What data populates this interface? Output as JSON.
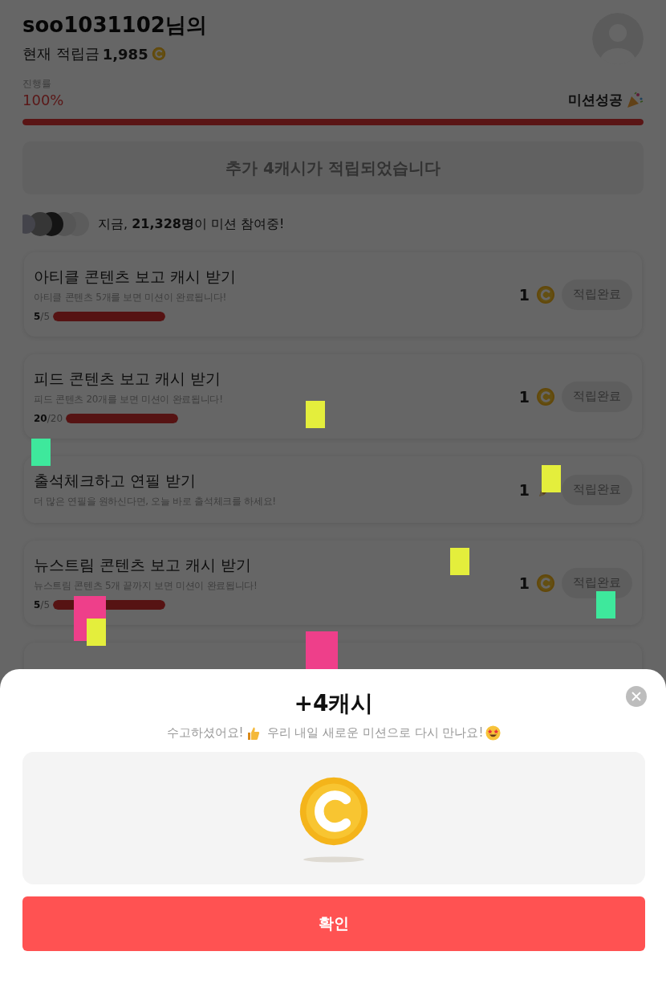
{
  "header": {
    "username": "soo1031102님의",
    "balance_label": "현재 적립금",
    "balance": "1,985"
  },
  "progress": {
    "label": "진행률",
    "percent": "100%",
    "level": 1,
    "status": "미션성공"
  },
  "notice": "추가 4캐시가 적립되었습니다",
  "participants": "지금, **21,328명**이 미션 참여중!",
  "missions": [
    {
      "kind": "progress",
      "title": "아티클 콘텐츠 보고 캐시 받기",
      "description": "아티클 콘텐츠 5개를 보면 미션이 완료됩니다!",
      "count": "**5**/5",
      "level": 1,
      "reward": {
        "amount": "1",
        "kind": "coin"
      },
      "button": "적립완료",
      "completed": true
    },
    {
      "kind": "progress",
      "title": "피드 콘텐츠 보고 캐시 받기",
      "description": "피드 콘텐츠 20개를 보면 미션이 완료됩니다!",
      "count": "**20**/20",
      "level": 1,
      "reward": {
        "amount": "1",
        "kind": "coin"
      },
      "button": "적립완료",
      "completed": true
    },
    {
      "kind": "plain",
      "title": "출석체크하고 연필 받기",
      "description": "더 많은 연필을 원하신다면, 오늘 바로 출석체크를 하세요!",
      "reward": {
        "amount": "1",
        "kind": "pencil"
      },
      "button": "적립완료",
      "completed": true
    },
    {
      "kind": "progress",
      "title": "뉴스트림 콘텐츠 보고 캐시 받기",
      "description": "뉴스트림 콘텐츠 5개 끝까지 보면 미션이 완료됩니다!",
      "count": "**5**/5",
      "level": 1,
      "reward": {
        "amount": "1",
        "kind": "coin"
      },
      "button": "적립완료",
      "completed": true
    },
    {
      "kind": "hidden"
    }
  ],
  "popup": {
    "title": "+4캐시",
    "message_1": "수고하셨어요!",
    "message_2": "우리 내일 새로운 미션으로 다시 만나요!",
    "button": "확인"
  }
}
